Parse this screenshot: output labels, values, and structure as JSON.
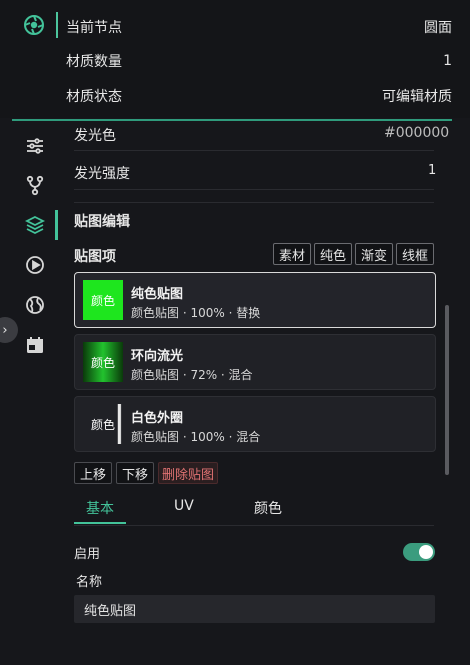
{
  "node": {
    "rows": [
      {
        "label": "当前节点",
        "value": "圆面"
      },
      {
        "label": "材质数量",
        "value": "1"
      },
      {
        "label": "材质状态",
        "value": "可编辑材质"
      }
    ]
  },
  "props": {
    "emissive_label": "发光色",
    "emissive_value": "#000000",
    "intensity_label": "发光强度",
    "intensity_value": "1"
  },
  "texture_edit": {
    "section_title": "贴图编辑",
    "items_label": "贴图项",
    "add_buttons": [
      "素材",
      "纯色",
      "渐变",
      "线框"
    ],
    "items": [
      {
        "swatch": "颜色",
        "title": "纯色贴图",
        "subtitle": "颜色贴图 · 100% · 替换"
      },
      {
        "swatch": "颜色",
        "title": "环向流光",
        "subtitle": "颜色贴图 · 72% · 混合"
      },
      {
        "swatch": "颜色",
        "title": "白色外圈",
        "subtitle": "颜色贴图 · 100% · 混合"
      }
    ],
    "actions": [
      "上移",
      "下移",
      "删除贴图"
    ]
  },
  "tabs": [
    "基本",
    "UV",
    "颜色"
  ],
  "basic": {
    "enabled_label": "启用",
    "enabled": true,
    "name_label": "名称",
    "name_value": "纯色贴图"
  },
  "colors": {
    "accent": "#43c39a",
    "danger_text": "#e07272",
    "swatch_green": "#1ee61e"
  },
  "icons": [
    "logo-icon",
    "sliders-icon",
    "branch-icon",
    "layers-icon",
    "play-icon",
    "globe-icon",
    "calendar-icon",
    "chevron-right-icon"
  ]
}
